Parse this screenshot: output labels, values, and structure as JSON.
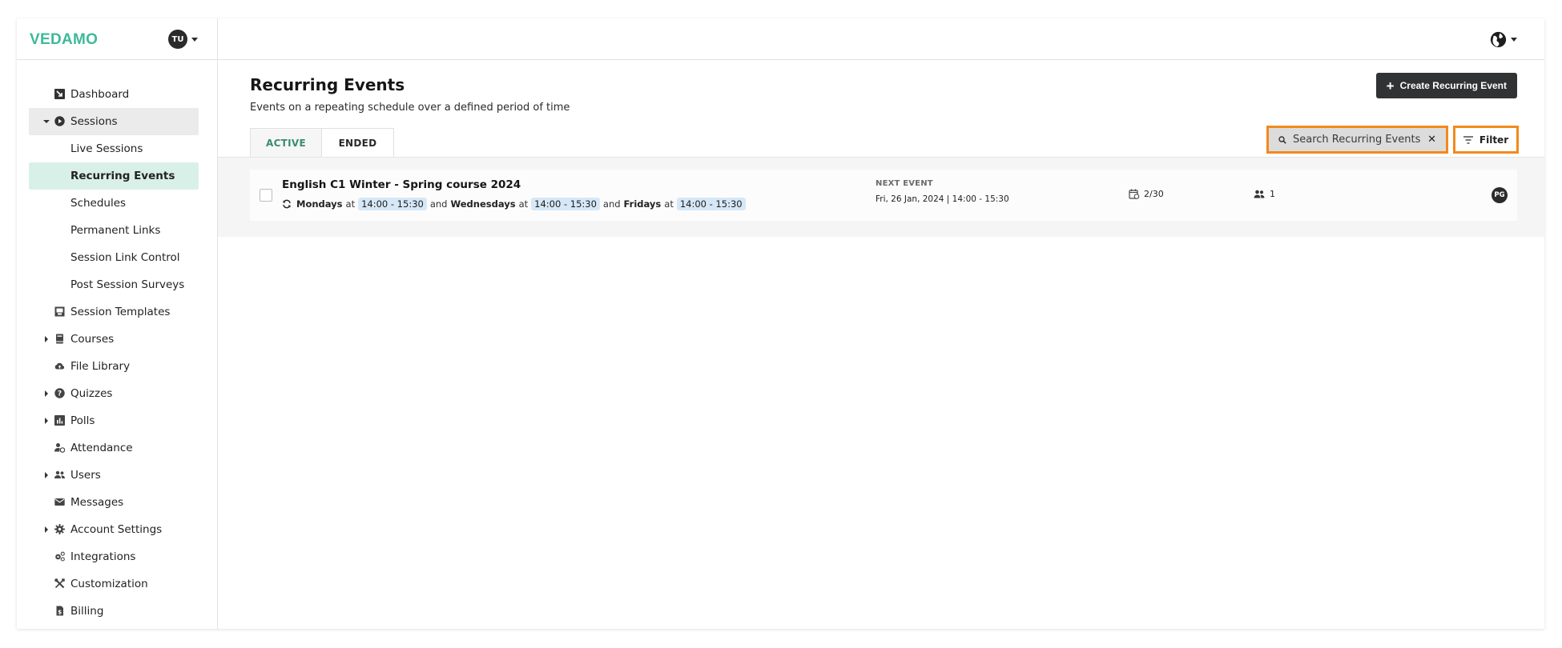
{
  "brand": {
    "logo": "VEDAMO",
    "accent": "#3db99a"
  },
  "user": {
    "initials": "TU"
  },
  "sidebar": {
    "items": [
      {
        "label": "Dashboard",
        "icon": "dashboard-icon",
        "expandable": false
      },
      {
        "label": "Sessions",
        "icon": "play-circle-icon",
        "expandable": true,
        "expanded": true
      },
      {
        "label": "Live Sessions",
        "sub": true
      },
      {
        "label": "Recurring Events",
        "sub": true,
        "active": true
      },
      {
        "label": "Schedules",
        "sub": true
      },
      {
        "label": "Permanent Links",
        "sub": true
      },
      {
        "label": "Session Link Control",
        "sub": true
      },
      {
        "label": "Post Session Surveys",
        "sub": true
      },
      {
        "label": "Session Templates",
        "icon": "template-icon",
        "expandable": false
      },
      {
        "label": "Courses",
        "icon": "book-icon",
        "expandable": true
      },
      {
        "label": "File Library",
        "icon": "cloud-upload-icon",
        "expandable": false
      },
      {
        "label": "Quizzes",
        "icon": "question-circle-icon",
        "expandable": true
      },
      {
        "label": "Polls",
        "icon": "bar-chart-icon",
        "expandable": true
      },
      {
        "label": "Attendance",
        "icon": "user-clock-icon",
        "expandable": false
      },
      {
        "label": "Users",
        "icon": "users-icon",
        "expandable": true
      },
      {
        "label": "Messages",
        "icon": "envelope-icon",
        "expandable": false
      },
      {
        "label": "Account Settings",
        "icon": "gear-icon",
        "expandable": true
      },
      {
        "label": "Integrations",
        "icon": "cogs-icon",
        "expandable": false
      },
      {
        "label": "Customization",
        "icon": "tools-icon",
        "expandable": false
      },
      {
        "label": "Billing",
        "icon": "invoice-icon",
        "expandable": false
      }
    ]
  },
  "header": {
    "language_icon": "globe-icon"
  },
  "page": {
    "title": "Recurring Events",
    "subtitle": "Events on a repeating schedule over a defined period of time",
    "create_button": "Create Recurring Event"
  },
  "tabs": [
    {
      "label": "ACTIVE",
      "active": true
    },
    {
      "label": "ENDED",
      "active": false
    }
  ],
  "search": {
    "placeholder": "Search Recurring Events",
    "value": ""
  },
  "filter": {
    "label": "Filter"
  },
  "events": [
    {
      "title": "English C1 Winter - Spring course 2024",
      "schedule": [
        {
          "day": "Mondays",
          "at": "at",
          "time": "14:00 - 15:30"
        },
        {
          "joiner": "and",
          "day": "Wednesdays",
          "at": "at",
          "time": "14:00 - 15:30"
        },
        {
          "joiner": "and",
          "day": "Fridays",
          "at": "at",
          "time": "14:00 - 15:30"
        }
      ],
      "next_event_label": "NEXT EVENT",
      "next_event_value": "Fri, 26 Jan, 2024 | 14:00 - 15:30",
      "progress": "2/30",
      "participants": "1",
      "owner_initials": "PG"
    }
  ],
  "colors": {
    "highlight_outline": "#f28a1c",
    "active_nav": "#d9f0e8",
    "time_chip": "#d6e8f7",
    "dark_button": "#303233"
  }
}
